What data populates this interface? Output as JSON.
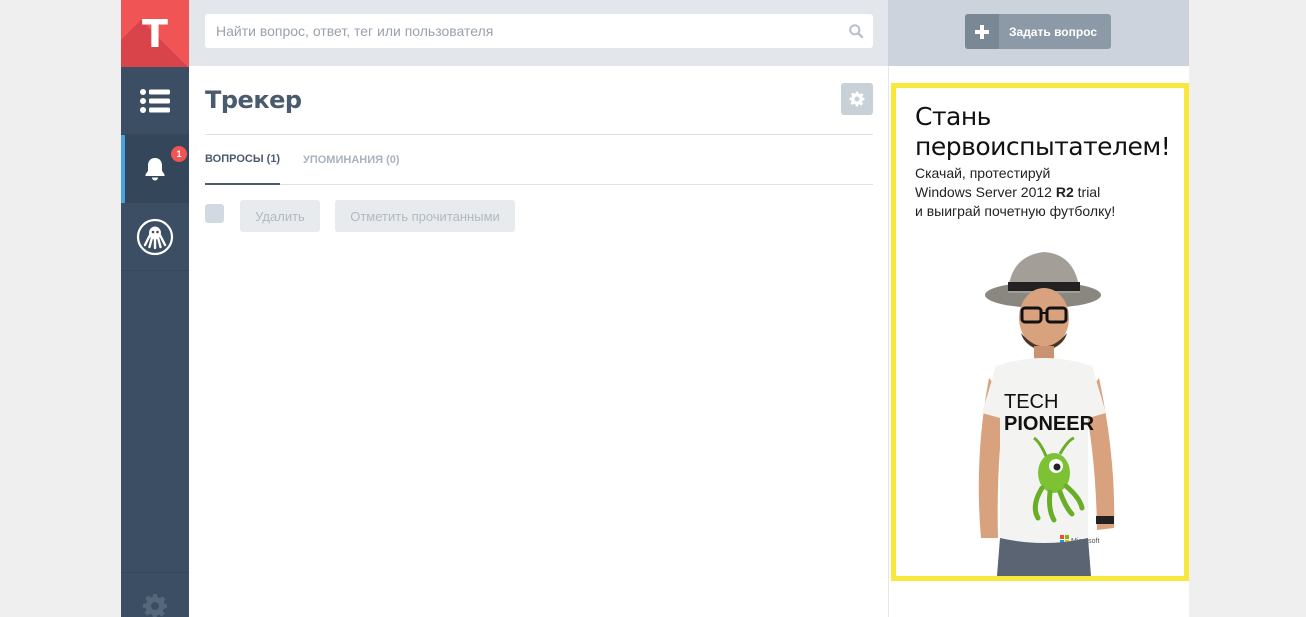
{
  "app": {
    "logo_letter": "T",
    "notification_count": "1"
  },
  "search": {
    "placeholder": "Найти вопрос, ответ, тег или пользователя"
  },
  "ask_button": {
    "label": "Задать вопрос"
  },
  "page": {
    "title": "Трекер"
  },
  "tabs": [
    {
      "label": "ВОПРОСЫ (1)",
      "active": true
    },
    {
      "label": "УПОМИНАНИЯ (0)",
      "active": false
    }
  ],
  "actions": {
    "delete_label": "Удалить",
    "mark_read_label": "Отметить прочитанными"
  },
  "ad": {
    "title_line1": "Стань",
    "title_line2": "первоиспытателем!",
    "text_line1": "Скачай, протестируй",
    "text_line2_pre": "Windows Server 2012 ",
    "text_line2_bold": "R2",
    "text_line2_post": " trial",
    "text_line3": "и выиграй почетную футболку!",
    "shirt_line1": "TECH",
    "shirt_line2": "PIONEER",
    "shirt_brand": "Microsoft",
    "border_color": "#f8e83a"
  },
  "icons": {
    "sidebar": [
      "list-icon",
      "bell-icon",
      "octopus-icon",
      "gear-icon"
    ],
    "search": "search-icon",
    "ask": "plus-icon",
    "settings": "gear-icon"
  },
  "colors": {
    "sidebar": "#3c4e63",
    "logo": "#f05454",
    "accent": "#4aa3df",
    "header": "#e3e6ea"
  }
}
